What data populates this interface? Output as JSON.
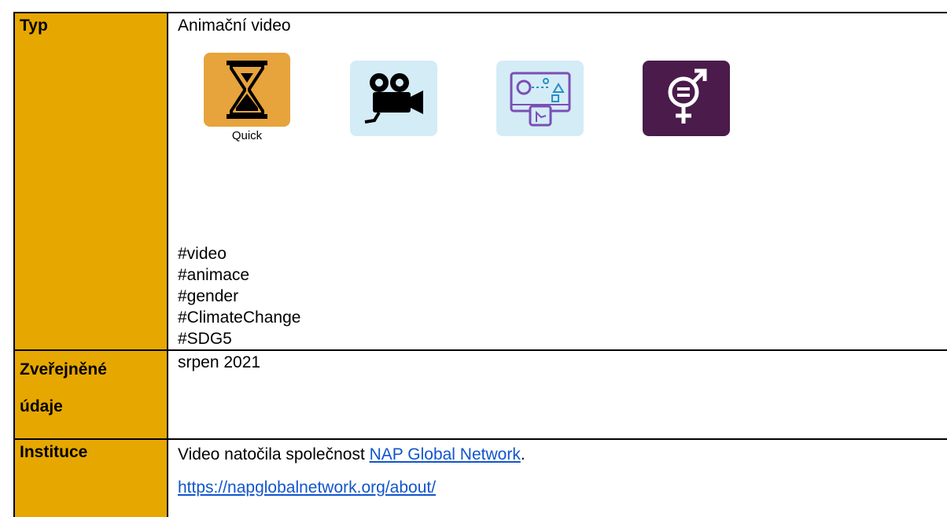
{
  "rows": {
    "type": {
      "label": "Typ",
      "value": "Animační video",
      "icons": [
        {
          "name": "hourglass-icon",
          "caption": "Quick",
          "color": "#e7a33c"
        },
        {
          "name": "film-camera-icon",
          "color": "#d4ecf6"
        },
        {
          "name": "touchscreen-icon",
          "color": "#d4ecf6"
        },
        {
          "name": "gender-equality-icon",
          "color": "#4a1b4b"
        }
      ],
      "tags": [
        "#video",
        "#animace",
        "#gender",
        "#ClimateChange",
        "#SDG5"
      ]
    },
    "published": {
      "label_line1": "Zveřejněné",
      "label_line2": "údaje",
      "value": "srpen 2021"
    },
    "institution": {
      "label": "Instituce",
      "text_before": "Video natočila společnost ",
      "link_text": "NAP Global Network",
      "text_after": ".",
      "url": "https://napglobalnetwork.org/about/"
    }
  },
  "colors": {
    "label_background": "#e6a800",
    "link": "#1155cc"
  }
}
